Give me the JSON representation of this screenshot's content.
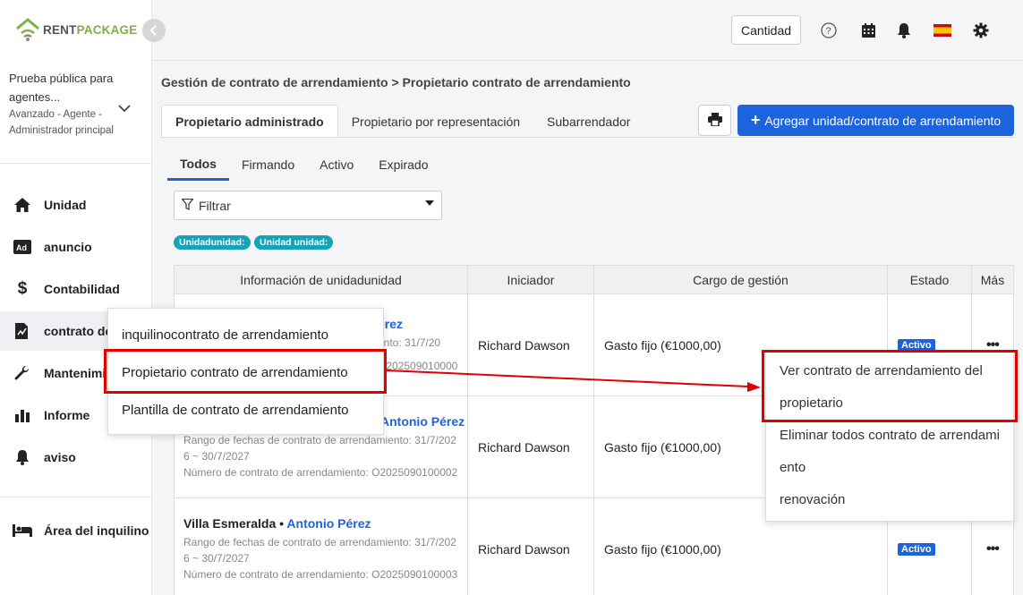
{
  "brand": {
    "rent": "RENT",
    "package": "PACKAGE"
  },
  "account": {
    "name": "Prueba pública para agentes...",
    "role": "Avanzado - Agente - Administrador principal"
  },
  "sidebar": {
    "items": [
      {
        "label": "Unidad",
        "icon": "home-icon"
      },
      {
        "label": "anuncio",
        "icon": "ad-icon"
      },
      {
        "label": "Contabilidad",
        "icon": "dollar-icon"
      },
      {
        "label": "contrato de",
        "icon": "contract-icon"
      },
      {
        "label": "Mantenimi",
        "icon": "wrench-icon"
      },
      {
        "label": "Informe",
        "icon": "chart-icon"
      },
      {
        "label": "aviso",
        "icon": "bell-icon"
      }
    ],
    "tenant_area": "Área del inquilino"
  },
  "topbar": {
    "cantidad": "Cantidad"
  },
  "breadcrumb": "Gestión de contrato de arrendamiento > Propietario contrato de arrendamiento",
  "tabs": [
    "Propietario administrado",
    "Propietario por representación",
    "Subarrendador"
  ],
  "add_button": "Agregar unidad/contrato de arrendamiento",
  "subtabs": [
    "Todos",
    "Firmando",
    "Activo",
    "Expirado"
  ],
  "filter": {
    "label": "Filtrar"
  },
  "tags": [
    "Unidadunidad:",
    "Unidad unidad:"
  ],
  "table": {
    "headers": [
      "Información de unidadunidad",
      "Iniciador",
      "Cargo de gestión",
      "Estado",
      "Más"
    ],
    "rows": [
      {
        "unit": "",
        "owner": "érez",
        "range": "ento: 31/7/20",
        "contract": "O202509010000",
        "initiator": "Richard Dawson",
        "fee": "Gasto fijo (€1000,00)",
        "status": "Activo"
      },
      {
        "unit": "",
        "owner": "Antonio Pérez",
        "range": "Rango de fechas de contrato de arrendamiento: 31/7/2026 ~ 30/7/2027",
        "contract": "Número de contrato de arrendamiento: O2025090100002",
        "initiator": "Richard Dawson",
        "fee": "Gasto fijo (€1000,00)",
        "status": ""
      },
      {
        "unit": "Villa Esmeralda",
        "owner": "Antonio Pérez",
        "range": "Rango de fechas de contrato de arrendamiento: 31/7/2026 ~ 30/7/2027",
        "contract": "Número de contrato de arrendamiento: O2025090100003",
        "initiator": "Richard Dawson",
        "fee": "Gasto fijo (€1000,00)",
        "status": "Activo"
      }
    ]
  },
  "contract_menu": [
    "inquilinocontrato de arrendamiento",
    "Propietario contrato de arrendamiento",
    "Plantilla de contrato de arrendamiento"
  ],
  "more_menu": [
    "Ver contrato de arrendamiento del propietario",
    "Eliminar todos contrato de arrendamiento",
    "renovación"
  ],
  "colors": {
    "accent": "#1d63dc",
    "highlight": "#e00000",
    "tag": "#17a2b8",
    "brand_green": "#7cb342"
  }
}
